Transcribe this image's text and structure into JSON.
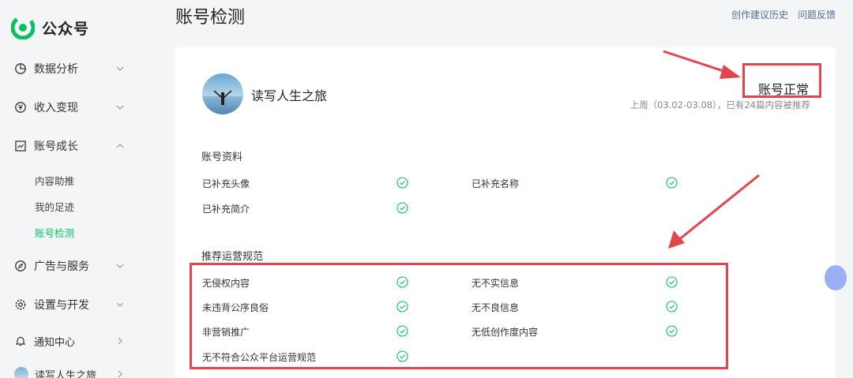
{
  "app": {
    "name": "公众号"
  },
  "sidebar": {
    "items": [
      {
        "label": "数据分析",
        "icon": "pie-chart-icon"
      },
      {
        "label": "收入变现",
        "icon": "yen-circle-icon"
      },
      {
        "label": "账号成长",
        "icon": "trend-chart-icon"
      },
      {
        "label": "广告与服务",
        "icon": "compass-icon"
      },
      {
        "label": "设置与开发",
        "icon": "gear-icon"
      },
      {
        "label": "通知中心",
        "icon": "bell-icon"
      },
      {
        "label": "读写人生之旅",
        "icon": "avatar"
      }
    ],
    "sub_items": [
      {
        "label": "内容助推",
        "active": false
      },
      {
        "label": "我的足迹",
        "active": false
      },
      {
        "label": "账号检测",
        "active": true
      }
    ]
  },
  "header": {
    "title": "账号检测",
    "links": [
      "创作建议历史",
      "问题反馈"
    ]
  },
  "account": {
    "name": "读写人生之旅",
    "status": "账号正常",
    "status_detail": "上周（03.02-03.08），已有24篇内容被推荐"
  },
  "profile_section": {
    "title": "账号资料",
    "items": [
      "已补充头像",
      "已补充名称",
      "已补充简介"
    ]
  },
  "rules_section": {
    "title": "推荐运营规范",
    "items": [
      "无侵权内容",
      "无不实信息",
      "未违背公序良俗",
      "无不良信息",
      "非营销推广",
      "无低创作度内容",
      "无不符合公众平台运营规范"
    ]
  },
  "colors": {
    "accent": "#07c160",
    "highlight": "#e2454b",
    "link": "#576b95"
  }
}
